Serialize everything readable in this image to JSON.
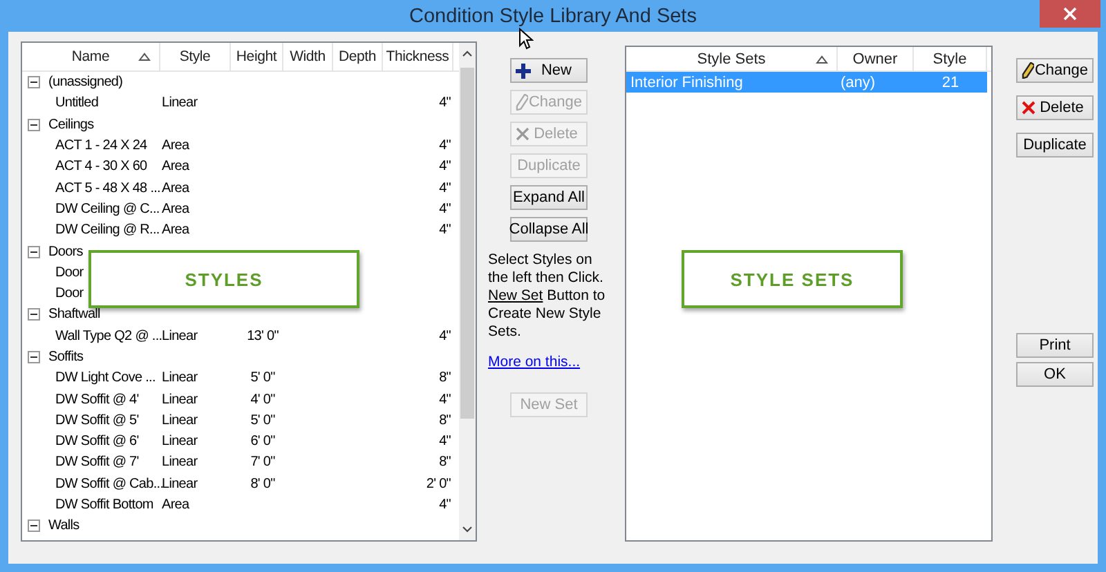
{
  "window": {
    "title": "Condition Style Library And Sets"
  },
  "styles_table": {
    "columns": [
      {
        "label": "Name",
        "sorted": true
      },
      {
        "label": "Style",
        "sorted": false
      },
      {
        "label": "Height",
        "sorted": false
      },
      {
        "label": "Width",
        "sorted": false
      },
      {
        "label": "Depth",
        "sorted": false
      },
      {
        "label": "Thickness",
        "sorted": false
      }
    ],
    "groups": [
      {
        "name": "(unassigned)",
        "expanded": true,
        "children": [
          {
            "name": "Untitled",
            "style": "Linear",
            "thickness": "4\""
          }
        ]
      },
      {
        "name": "Ceilings",
        "expanded": true,
        "children": [
          {
            "name": "ACT 1 - 24 X 24",
            "style": "Area",
            "thickness": "4\""
          },
          {
            "name": "ACT 4 - 30 X 60",
            "style": "Area",
            "thickness": "4\""
          },
          {
            "name": "ACT 5 - 48 X 48 ...",
            "style": "Area",
            "thickness": "4\""
          },
          {
            "name": "DW Ceiling @ C...",
            "style": "Area",
            "thickness": "4\""
          },
          {
            "name": "DW Ceiling @ R...",
            "style": "Area",
            "thickness": "4\""
          }
        ]
      },
      {
        "name": "Doors",
        "expanded": true,
        "children": [
          {
            "name": "Door"
          },
          {
            "name": "Door"
          }
        ]
      },
      {
        "name": "Shaftwall",
        "expanded": true,
        "children": [
          {
            "name": "Wall Type Q2 @ ...",
            "style": "Linear",
            "height": "13' 0\"",
            "thickness": "4\""
          }
        ]
      },
      {
        "name": "Soffits",
        "expanded": true,
        "children": [
          {
            "name": "DW Light Cove ...",
            "style": "Linear",
            "height": "5' 0\"",
            "thickness": "8\""
          },
          {
            "name": "DW Soffit @ 4'",
            "style": "Linear",
            "height": "4' 0\"",
            "thickness": "4\""
          },
          {
            "name": "DW Soffit @ 5'",
            "style": "Linear",
            "height": "5' 0\"",
            "thickness": "8\""
          },
          {
            "name": "DW Soffit @ 6'",
            "style": "Linear",
            "height": "6' 0\"",
            "thickness": "4\""
          },
          {
            "name": "DW Soffit @ 7'",
            "style": "Linear",
            "height": "7' 0\"",
            "thickness": "8\""
          },
          {
            "name": "DW Soffit @ Cab...",
            "style": "Linear",
            "height": "8' 0\"",
            "thickness": "2' 0\""
          },
          {
            "name": "DW Soffit Bottom",
            "style": "Area",
            "thickness": "4\""
          }
        ]
      },
      {
        "name": "Walls",
        "expanded": true
      }
    ]
  },
  "middle_buttons": [
    {
      "label": "New",
      "disabled": false
    },
    {
      "label": "Change",
      "disabled": true
    },
    {
      "label": "Delete",
      "disabled": true
    },
    {
      "label": "Duplicate",
      "disabled": true
    },
    {
      "label": "Expand All",
      "disabled": false
    },
    {
      "label": "Collapse All",
      "disabled": false
    }
  ],
  "instruction": {
    "before": "Select Styles on the left then Click. ",
    "underlined": "New Set",
    "after": " Button to Create New Style Sets."
  },
  "more_link": "More on this...",
  "new_set_button": {
    "label": "New Set",
    "disabled": true
  },
  "sets_table": {
    "columns": [
      {
        "label": "Style Sets",
        "sorted": true
      },
      {
        "label": "Owner",
        "sorted": false
      },
      {
        "label": "Style",
        "sorted": false
      }
    ],
    "rows": [
      {
        "name": "Interior Finishing",
        "owner": "(any)",
        "style": "21",
        "selected": true
      }
    ]
  },
  "side_buttons": [
    {
      "label": "Change",
      "disabled": false
    },
    {
      "label": "Delete",
      "disabled": false
    },
    {
      "label": "Duplicate",
      "disabled": false
    }
  ],
  "bottom_buttons": [
    {
      "label": "Print",
      "disabled": false
    },
    {
      "label": "OK",
      "disabled": false
    }
  ],
  "callouts": [
    {
      "text": "STYLES"
    },
    {
      "text": "STYLE SETS"
    }
  ]
}
